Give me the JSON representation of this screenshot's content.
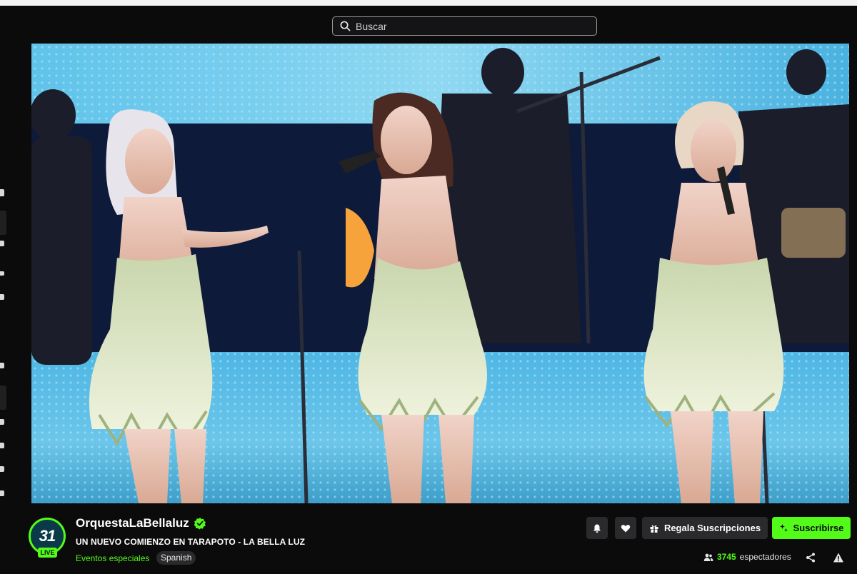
{
  "search": {
    "placeholder": "Buscar",
    "icon": "search-icon"
  },
  "channel": {
    "name": "OrquestaLaBellaluz",
    "verified_icon": "verified-badge-icon",
    "avatar_text": "31",
    "live_badge": "LIVE",
    "stream_title": "UN NUEVO COMIENZO EN TARAPOTO - LA BELLA LUZ",
    "category": "Eventos especiales",
    "language_tag": "Spanish"
  },
  "actions": {
    "notify_icon": "bell-icon",
    "follow_icon": "heart-icon",
    "gift_label": "Regala Suscripciones",
    "gift_icon": "gift-icon",
    "subscribe_label": "Suscribirse",
    "subscribe_icon": "sparkle-icon",
    "share_icon": "share-icon",
    "report_icon": "warning-icon"
  },
  "viewers": {
    "count": "3745",
    "label": "espectadores",
    "icon": "viewers-icon"
  },
  "colors": {
    "accent": "#53fc18",
    "background": "#0b0b0c",
    "button": "#2a2a2d"
  }
}
